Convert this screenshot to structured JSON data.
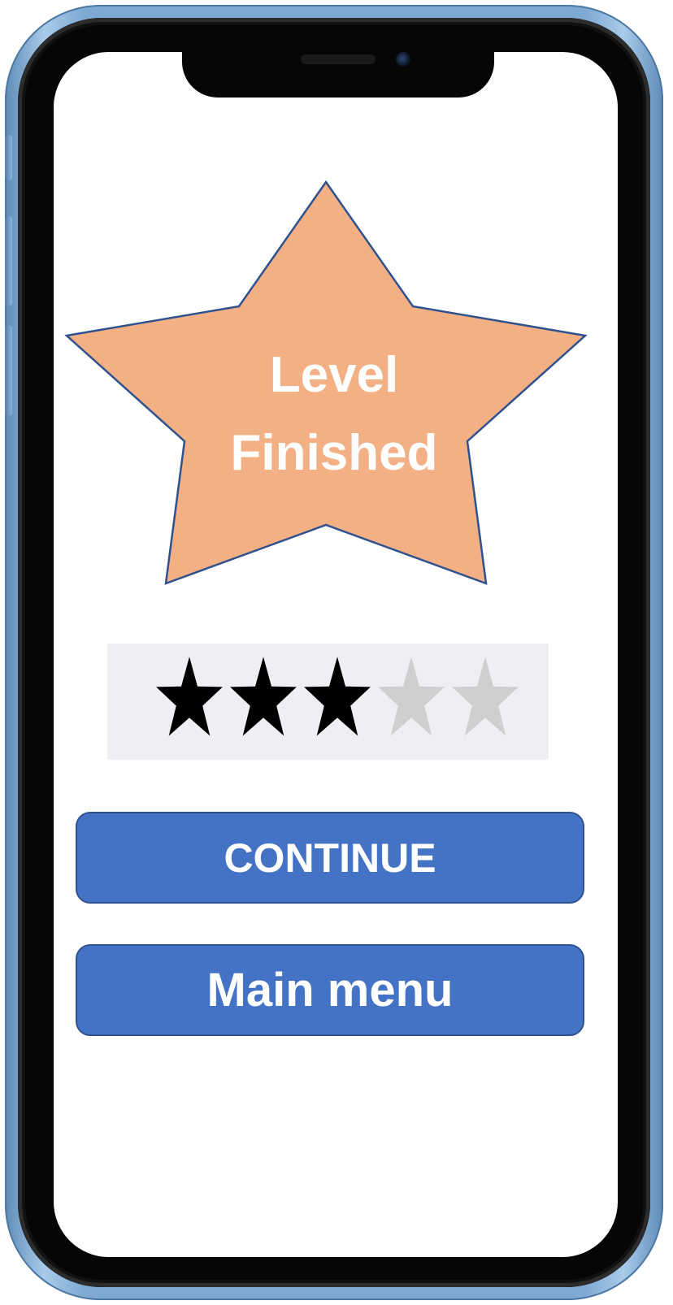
{
  "level_complete": {
    "title_line1": "Level",
    "title_line2": "Finished"
  },
  "rating": {
    "earned": 3,
    "max": 5
  },
  "buttons": {
    "continue_label": "CONTINUE",
    "main_menu_label": "Main menu"
  },
  "colors": {
    "star_fill": "#f2b084",
    "star_outline": "#2f528f",
    "button_fill": "#4472c4",
    "star_filled": "#000000",
    "star_empty": "#cfcfcf",
    "phone_frame": "#7ea9d3"
  }
}
